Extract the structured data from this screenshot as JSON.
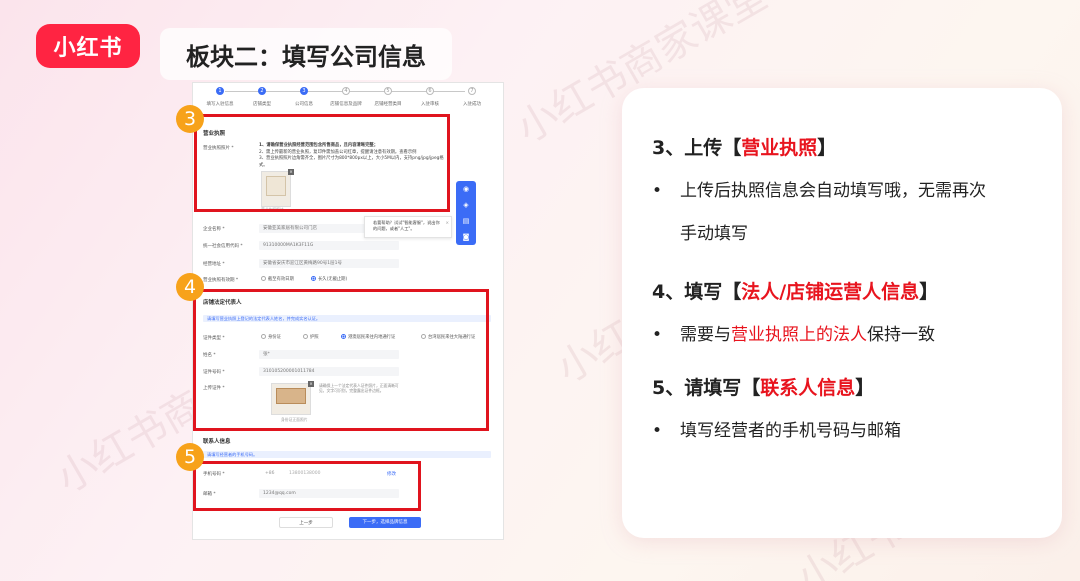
{
  "logo": {
    "text": "小红书"
  },
  "page_title": "板块二：填写公司信息",
  "watermark": "小红书商家课堂",
  "form": {
    "steps": [
      {
        "num": "1",
        "label": "填写入驻信息"
      },
      {
        "num": "2",
        "label": "店铺类型"
      },
      {
        "num": "3",
        "label": "公司信息"
      },
      {
        "num": "4",
        "label": "店铺信息及品牌"
      },
      {
        "num": "5",
        "label": "店铺经营类目"
      },
      {
        "num": "6",
        "label": "入驻审核"
      },
      {
        "num": "7",
        "label": "入驻成功"
      }
    ],
    "license": {
      "section_title": "营业执照",
      "field_label": "营业执照照片 *",
      "notes": [
        "1、请确保营业执照经营范围包含所售商品，且内容清晰完整；",
        "2、需上传最新的营业执照，复印件需加盖公司红章，提醒请注意有效期。查看示例",
        "3、营业执照照片边角需齐全，图片尺寸为800*800px以上，大小5M以内，支持png/jpg/jpeg格式。"
      ],
      "thumb_caption": "营业执照照片"
    },
    "company_rows": [
      {
        "label": "企业名称 *",
        "value": "安徽亚美家居有限公司门店"
      },
      {
        "label": "统一社会信用代码 *",
        "value": "91310000MA1K3F11G"
      },
      {
        "label": "经营地址 *",
        "value": "安徽省安庆市迎江区黄梅路90号1层1号"
      },
      {
        "label": "营业执照有效期 *",
        "value": ""
      }
    ],
    "validity_options": {
      "opt1": "截至有效日期",
      "opt2": "长久(无截止期)"
    },
    "tip": {
      "text": "若要帮助？试试\"智能客服\"，说出你的问题，或者\"人工\"。",
      "close": "×"
    },
    "legal": {
      "section_title": "店铺法定代表人",
      "info": "请填写营业执照上登记的法定代表人姓名，并完成实名认证。",
      "type_label": "证件类型 *",
      "type_options": [
        "身份证",
        "护照",
        "港澳居民来往内地通行证",
        "台湾居民来往大陆通行证"
      ],
      "name_label": "姓名 *",
      "name_value": "张*",
      "id_label": "证件号码 *",
      "id_value": "310105200001011784",
      "upload_label": "上传证件 *",
      "upload_note": "请确保上一个法定代表人证件照片，正面清晰可见，文字可识别，完整露出证件边框。",
      "upload_caption": "身份证正面照片"
    },
    "contact": {
      "section_title": "联系人信息",
      "info": "请填写经营者的手机号码。",
      "phone_label": "手机号码 *",
      "phone_prefix": "+86",
      "phone_value": "13800138000",
      "phone_action": "修改",
      "email_label": "邮箱 *",
      "email_value": "1234@qq.com"
    },
    "buttons": {
      "prev": "上一步",
      "next": "下一步，选择品牌信息"
    },
    "side_tools": [
      "◉",
      "◈",
      "▤",
      "◙"
    ]
  },
  "badges": [
    "3",
    "4",
    "5"
  ],
  "card": {
    "item3": {
      "prefix": "3、上传【",
      "highlight": "营业执照",
      "suffix": "】",
      "bullet": "上传后执照信息会自动填写哦，无需再次",
      "bullet_cont": "手动填写"
    },
    "item4": {
      "prefix": "4、填写【",
      "highlight": "法人/店铺运营人信息",
      "suffix": "】",
      "bullet_pre": "需要与",
      "bullet_red": "营业执照上的法人",
      "bullet_post": "保持一致"
    },
    "item5": {
      "prefix": "5、请填写【",
      "highlight": "联系人信息",
      "suffix": "】",
      "bullet": "填写经营者的手机号码与邮箱"
    }
  },
  "colors": {
    "brand": "#ff2442",
    "accent_blue": "#3b6cf6",
    "highlight_red": "#e0141e",
    "badge_orange": "#f7a21a"
  }
}
